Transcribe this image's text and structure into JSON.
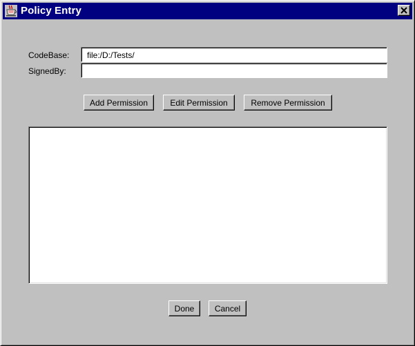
{
  "window": {
    "title": "Policy Entry",
    "app_icon": "java-coffee-cup-icon",
    "close_icon": "close-x-icon"
  },
  "form": {
    "codebase": {
      "label": "CodeBase:",
      "value": "file:/D:/Tests/"
    },
    "signedby": {
      "label": "SignedBy:",
      "value": ""
    }
  },
  "permission_buttons": {
    "add_label": "Add Permission",
    "edit_label": "Edit Permission",
    "remove_label": "Remove Permission"
  },
  "permissions_list": {
    "items": []
  },
  "footer": {
    "done_label": "Done",
    "cancel_label": "Cancel"
  },
  "colors": {
    "titlebar": "#000080",
    "window_bg": "#c0c0c0",
    "field_bg": "#ffffff"
  }
}
